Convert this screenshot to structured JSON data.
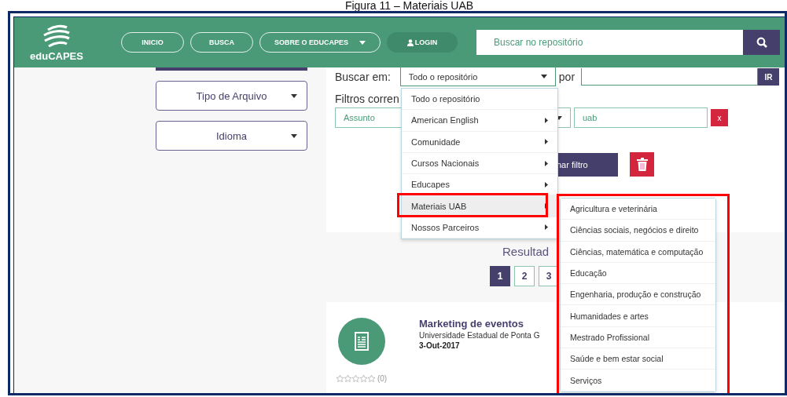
{
  "caption": "Figura 11 – Materiais UAB",
  "header": {
    "logo_text": "eduCAPES",
    "search": {
      "placeholder": "Buscar no repositório"
    },
    "nav": [
      {
        "label": "INICIO",
        "kind": "outline"
      },
      {
        "label": "BUSCA",
        "kind": "outline"
      },
      {
        "label": "SOBRE O EDUCAPES",
        "kind": "dropdown"
      },
      {
        "label": "LOGIN",
        "kind": "login"
      }
    ]
  },
  "sidebar": {
    "filters": [
      "Tipo de Arquivo",
      "Idioma"
    ]
  },
  "search_form": {
    "scope_label": "Buscar em:",
    "scope_value": "Todo o repositório",
    "by_label": "por",
    "go_button": "IR",
    "filters_label": "Filtros corren",
    "filter_field": "Assunto",
    "filter_value": "uab",
    "remove_button": "x",
    "add_filter_button": "nar filtro"
  },
  "scope_menu": {
    "items": [
      {
        "label": "Todo o repositório",
        "has_submenu": false,
        "selected": false
      },
      {
        "label": "American English",
        "has_submenu": true,
        "selected": false
      },
      {
        "label": "Comunidade",
        "has_submenu": true,
        "selected": false
      },
      {
        "label": "Cursos Nacionais",
        "has_submenu": true,
        "selected": false
      },
      {
        "label": "Educapes",
        "has_submenu": true,
        "selected": false
      },
      {
        "label": "Materiais UAB",
        "has_submenu": true,
        "selected": true
      },
      {
        "label": "Nossos Parceiros",
        "has_submenu": true,
        "selected": false
      }
    ]
  },
  "submenu": {
    "items": [
      "Agricultura e veterinária",
      "Ciências sociais, negócios e direito",
      "Ciências, matemática e computação",
      "Educação",
      "Engenharia, produção e construção",
      "Humanidades e artes",
      "Mestrado Profissional",
      "Saúde e bem estar social",
      "Serviços"
    ]
  },
  "results": {
    "heading": "Resultad",
    "pages": [
      {
        "label": "1",
        "selected": true
      },
      {
        "label": "2",
        "selected": false
      },
      {
        "label": "3",
        "selected": false
      }
    ],
    "items": [
      {
        "title": "Marketing de eventos",
        "publisher": "Universidade Estadual de Ponta G",
        "date": "3-Out-2017",
        "stars": 0,
        "rating_count": "(0)"
      }
    ]
  }
}
